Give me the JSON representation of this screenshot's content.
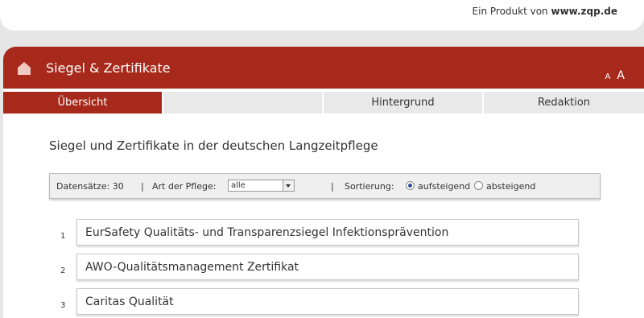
{
  "topbar": {
    "prefix": "Ein Produkt von",
    "brand": "www.zqp.de"
  },
  "header": {
    "title": "Siegel & Zertifikate",
    "font_small": "A",
    "font_large": "A",
    "accent_color": "#a6291b"
  },
  "tabs": [
    {
      "label": "Übersicht",
      "active": true
    },
    {
      "label": ""
    },
    {
      "label": "Hintergrund"
    },
    {
      "label": "Redaktion"
    }
  ],
  "page_heading": "Siegel und Zertifikate in der deutschen Langzeitpflege",
  "filter": {
    "records_label": "Datensätze: 30",
    "sep": "|",
    "care_type_label": "Art der Pflege:",
    "care_type_value": "alle",
    "sort_label": "Sortierung:",
    "sort_asc": "aufsteigend",
    "sort_desc": "absteigend"
  },
  "items": [
    {
      "num": "1",
      "title": "EurSafety Qualitäts- und Transparenzsiegel Infektionsprävention"
    },
    {
      "num": "2",
      "title": "AWO-Qualitätsmanagement Zertifikat"
    },
    {
      "num": "3",
      "title": "Caritas Qualität"
    }
  ]
}
